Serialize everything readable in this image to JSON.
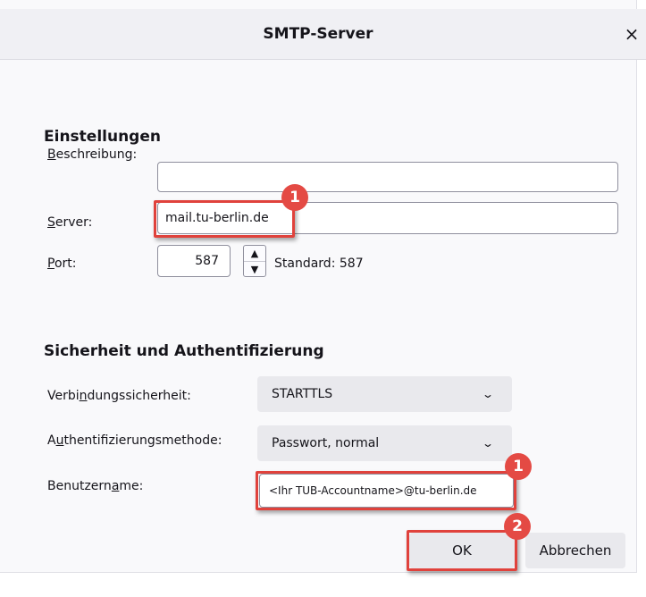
{
  "dialog": {
    "title": "SMTP-Server",
    "close_symbol": "×"
  },
  "settings": {
    "section_title": "Einstellungen",
    "description": {
      "label_first": "B",
      "label_rest": "eschreibung:",
      "value": ""
    },
    "server": {
      "label_first": "S",
      "label_rest": "erver:",
      "value": "mail.tu-berlin.de"
    },
    "port": {
      "label_first": "P",
      "label_rest": "ort:",
      "value": "587",
      "default_label": "Standard:",
      "default_value": "587"
    }
  },
  "security": {
    "section_title": "Sicherheit und Authentifizierung",
    "connection": {
      "label_pre": "Verbi",
      "label_u": "n",
      "label_post": "dungssicherheit:",
      "value": "STARTTLS"
    },
    "auth_method": {
      "label_pre": "A",
      "label_u": "u",
      "label_post": "thentifizierungsmethode:",
      "value": "Passwort, normal"
    },
    "username": {
      "label_pre": "Benutzern",
      "label_u": "a",
      "label_post": "me:",
      "value": "<Ihr TUB-Accountname>@tu-berlin.de"
    }
  },
  "buttons": {
    "ok": "OK",
    "cancel": "Abbrechen"
  },
  "annotations": {
    "badge_server": "1",
    "badge_username": "1",
    "badge_ok": "2"
  },
  "colors": {
    "highlight": "#e0423c",
    "badge": "#e44a44"
  }
}
